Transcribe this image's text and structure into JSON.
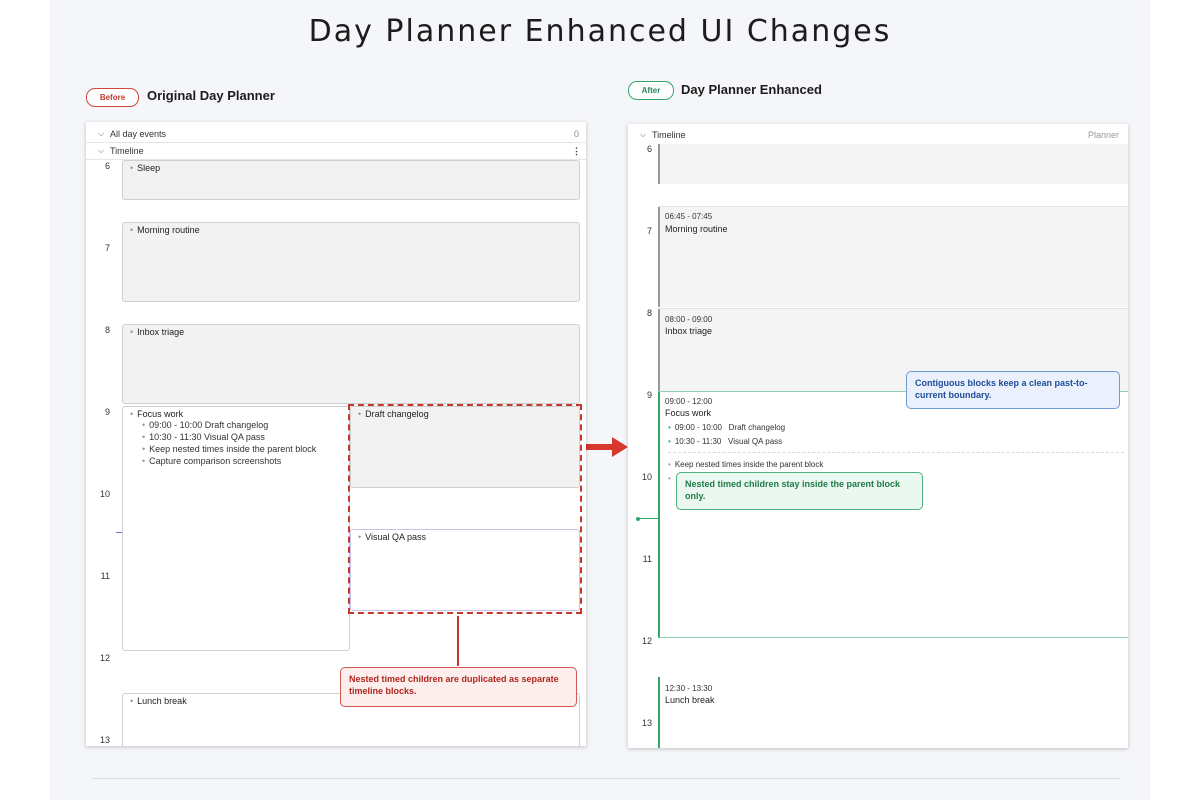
{
  "page_title": "Day Planner Enhanced UI Changes",
  "before": {
    "badge": "Before",
    "title": "Original Day Planner",
    "all_day_label": "All day events",
    "all_day_count": "0",
    "timeline_label": "Timeline",
    "more_icon": "⋮",
    "hours": [
      "6",
      "7",
      "8",
      "9",
      "10",
      "11",
      "12",
      "13"
    ],
    "blocks": {
      "sleep": "Sleep",
      "morning": "Morning routine",
      "inbox": "Inbox triage",
      "focus": "Focus work",
      "draft": "Draft changelog",
      "visual_qa": "Visual QA pass",
      "lunch": "Lunch break"
    },
    "focus_children": [
      "09:00 - 10:00 Draft changelog",
      "10:30 - 11:30 Visual QA pass",
      "Keep nested times inside the parent block",
      "Capture comparison screenshots"
    ],
    "callout": "Nested timed children are duplicated as separate timeline blocks."
  },
  "after": {
    "badge": "After",
    "title": "Day Planner Enhanced",
    "timeline_label": "Timeline",
    "planner_label": "Planner",
    "hours": [
      "6",
      "7",
      "8",
      "9",
      "10",
      "11",
      "12",
      "13"
    ],
    "blocks": {
      "morning": {
        "time": "06:45 - 07:45",
        "title": "Morning routine"
      },
      "inbox": {
        "time": "08:00 - 09:00",
        "title": "Inbox triage"
      },
      "focus": {
        "time": "09:00 - 12:00",
        "title": "Focus work"
      },
      "lunch": {
        "time": "12:30 - 13:30",
        "title": "Lunch break"
      }
    },
    "focus_children": [
      {
        "time": "09:00 - 10:00",
        "title": "Draft changelog"
      },
      {
        "time": "10:30 - 11:30",
        "title": "Visual QA pass"
      }
    ],
    "note": "Keep nested times inside the parent block",
    "callout_blue": "Contiguous blocks keep a clean past-to-current boundary.",
    "callout_green": "Nested timed children stay inside the parent block only."
  },
  "colors": {
    "accent_red": "#c8352b",
    "accent_green": "#33a66b",
    "accent_blue": "#6f9bd6"
  }
}
